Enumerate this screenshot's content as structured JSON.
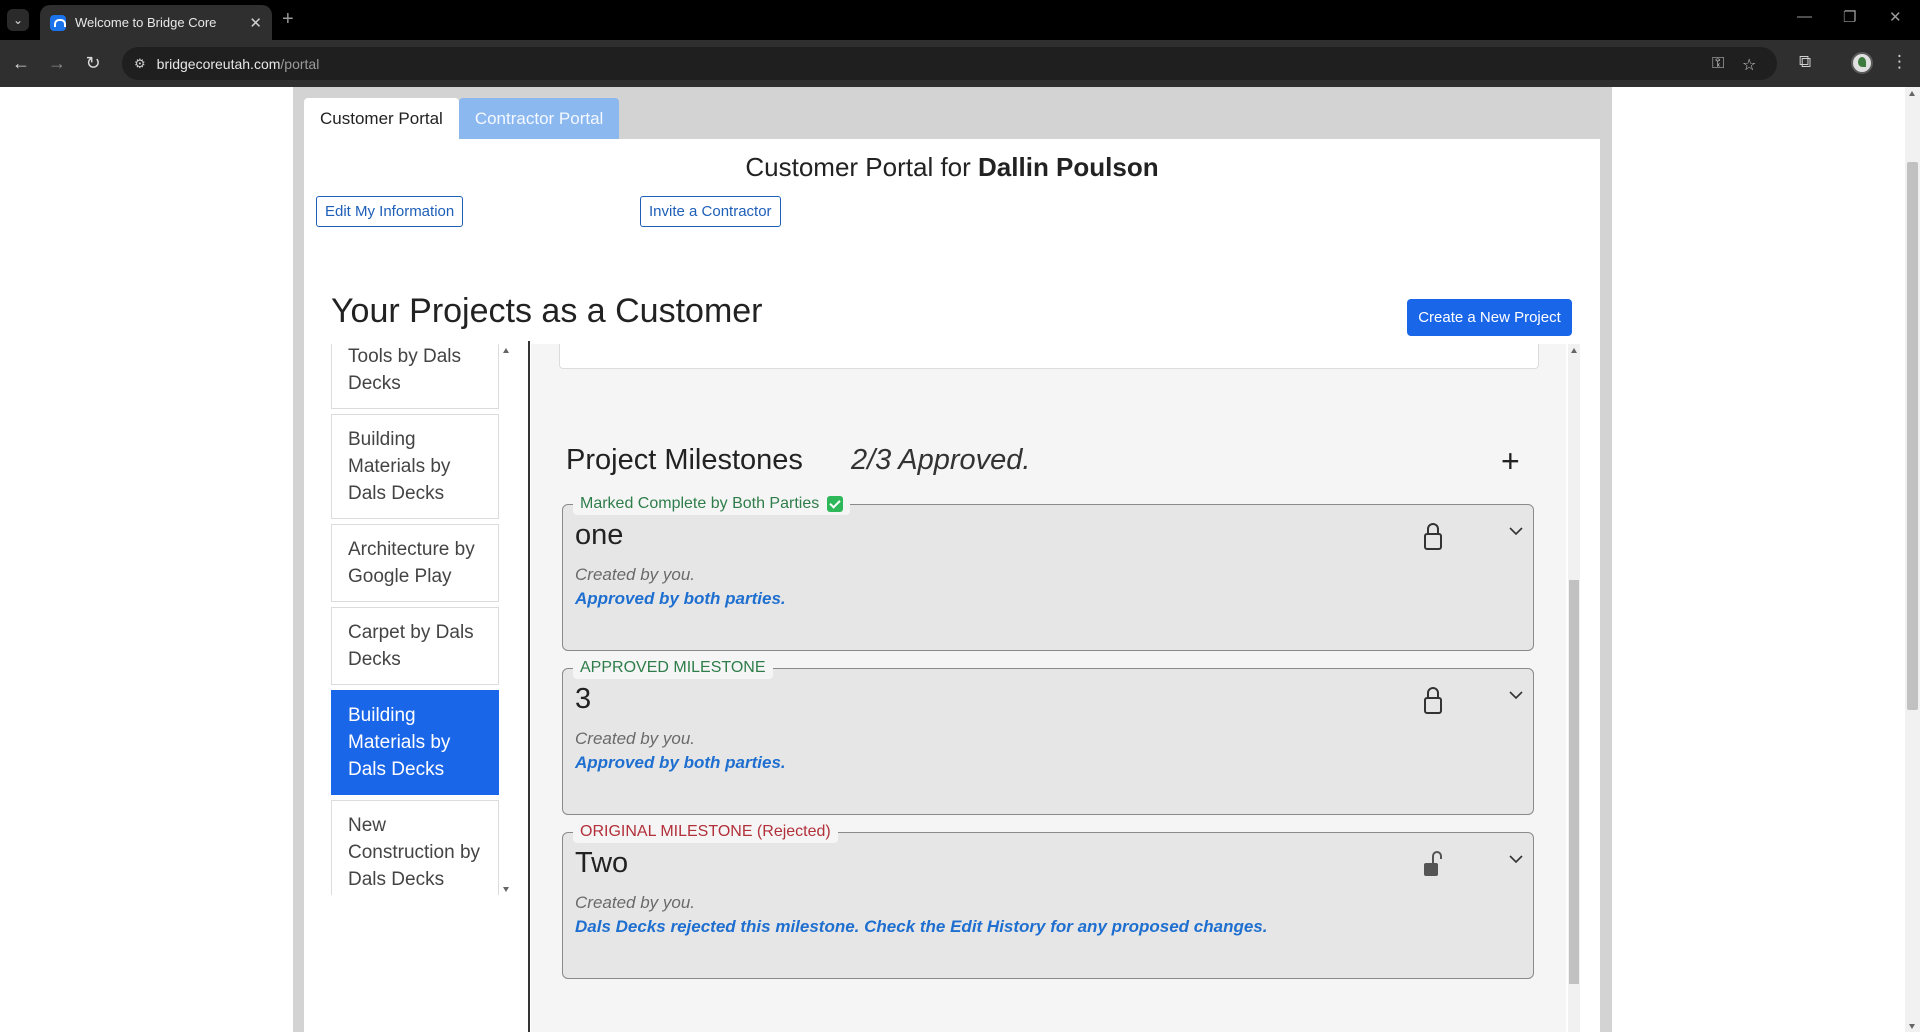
{
  "browser": {
    "tab_title": "Welcome to Bridge Core",
    "url_host": "bridgecoreutah.com",
    "url_path": "/portal"
  },
  "portal": {
    "tabs": [
      "Customer Portal",
      "Contractor Portal"
    ],
    "title_prefix": "Customer Portal for",
    "customer_name": "Dallin Poulson",
    "edit_info_label": "Edit My Information",
    "invite_label": "Invite a Contractor"
  },
  "projects": {
    "heading": "Your Projects as a Customer",
    "create_label": "Create a New Project",
    "items": [
      "Tools by Dals Decks",
      "Building Materials by Dals Decks",
      "Architecture by Google Play",
      "Carpet by Dals Decks",
      "Building Materials by Dals Decks",
      "New Construction by Dals Decks"
    ],
    "selected_index": 4
  },
  "milestones": {
    "heading": "Project Milestones",
    "status": "2/3 Approved.",
    "items": [
      {
        "legend": "Marked Complete by Both Parties",
        "title": "one",
        "created": "Created by you.",
        "note": "Approved by both parties.",
        "locked": true,
        "complete": true
      },
      {
        "legend": "APPROVED MILESTONE",
        "title": "3",
        "created": "Created by you.",
        "note": "Approved by both parties.",
        "locked": true,
        "complete": false
      },
      {
        "legend": "ORIGINAL MILESTONE (Rejected)",
        "title": "Two",
        "created": "Created by you.",
        "note": "Dals Decks rejected this milestone. Check the Edit History for any proposed changes.",
        "locked": false,
        "complete": false
      }
    ]
  },
  "colors": {
    "accent_blue": "#1a66e8",
    "inactive_tab": "#8cb8f0",
    "approved_green": "#2e7d4a",
    "rejected_red": "#b2303a",
    "note_blue": "#1e6fd0"
  }
}
